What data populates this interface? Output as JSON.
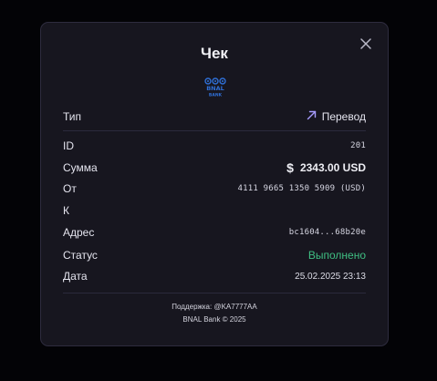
{
  "receipt": {
    "title": "Чек",
    "close_icon": "close-icon",
    "logo": {
      "name": "bnal-bank-logo",
      "lines": [
        "BNAL",
        "BANK"
      ]
    },
    "type": {
      "label": "Тип",
      "value": "Перевод",
      "icon": "arrow-up-right-icon"
    },
    "id": {
      "label": "ID",
      "value": "201"
    },
    "amount": {
      "label": "Сумма",
      "symbol": "$",
      "value": "2343.00 USD"
    },
    "from": {
      "label": "От",
      "value": "4111 9665 1350 5909 (USD)"
    },
    "to": {
      "label": "К",
      "value": ""
    },
    "address": {
      "label": "Адрес",
      "value": "bc1604...68b20e"
    },
    "status": {
      "label": "Статус",
      "value": "Выполнено"
    },
    "date": {
      "label": "Дата",
      "value": "25.02.2025 23:13"
    },
    "footer": {
      "support": "Поддержка: @KA7777AA",
      "copyright": "BNAL Bank © 2025"
    }
  },
  "colors": {
    "background": "#000000",
    "modal": "#17161f",
    "border": "#2e2c3e",
    "success": "#3fbf83",
    "accent": "#9b8cff",
    "logo_blue": "#2f6fd6"
  }
}
